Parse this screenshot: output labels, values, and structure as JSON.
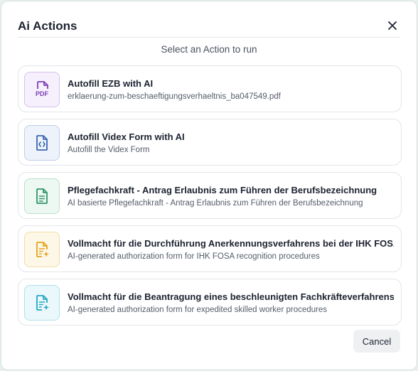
{
  "dialog": {
    "title": "Ai Actions",
    "subtitle": "Select an Action to run",
    "cancel_label": "Cancel",
    "close_icon": "close-icon"
  },
  "actions": [
    {
      "title": "Autofill EZB with AI",
      "subtitle": "erklaerung-zum-beschaeftigungsverhaeltnis_ba047549.pdf",
      "icon": "pdf-icon",
      "color": "#7e3fb8",
      "bg": "#f6effc",
      "border": "#d9c2ef",
      "badge": "PDF"
    },
    {
      "title": "Autofill Videx Form with AI",
      "subtitle": "Autofill the Videx Form",
      "icon": "code-file-icon",
      "color": "#3b66b0",
      "bg": "#eef3fb",
      "border": "#bccdea"
    },
    {
      "title": "Pflegefachkraft  - Antrag Erlaubnis zum Führen der Berufsbezeichnung",
      "subtitle": "AI basierte Pflegefachkraft  - Antrag Erlaubnis zum Führen der Berufsbezeichnung",
      "icon": "document-icon",
      "color": "#2f9468",
      "bg": "#edf8f2",
      "border": "#b9e0cb"
    },
    {
      "title": "Vollmacht für die Durchführung Anerkennungsverfahrens bei der IHK FOSA",
      "subtitle": "AI-generated authorization form for IHK FOSA recognition procedures",
      "icon": "ai-document-icon",
      "color": "#e3a51d",
      "bg": "#fdf7e8",
      "border": "#f3dca3"
    },
    {
      "title": "Vollmacht für die Beantragung eines beschleunigten Fachkräfteverfahrens",
      "subtitle": "AI-generated authorization form for expedited skilled worker procedures",
      "icon": "ai-document-icon",
      "color": "#23a7c4",
      "bg": "#ebf8fb",
      "border": "#afe0ec"
    }
  ]
}
